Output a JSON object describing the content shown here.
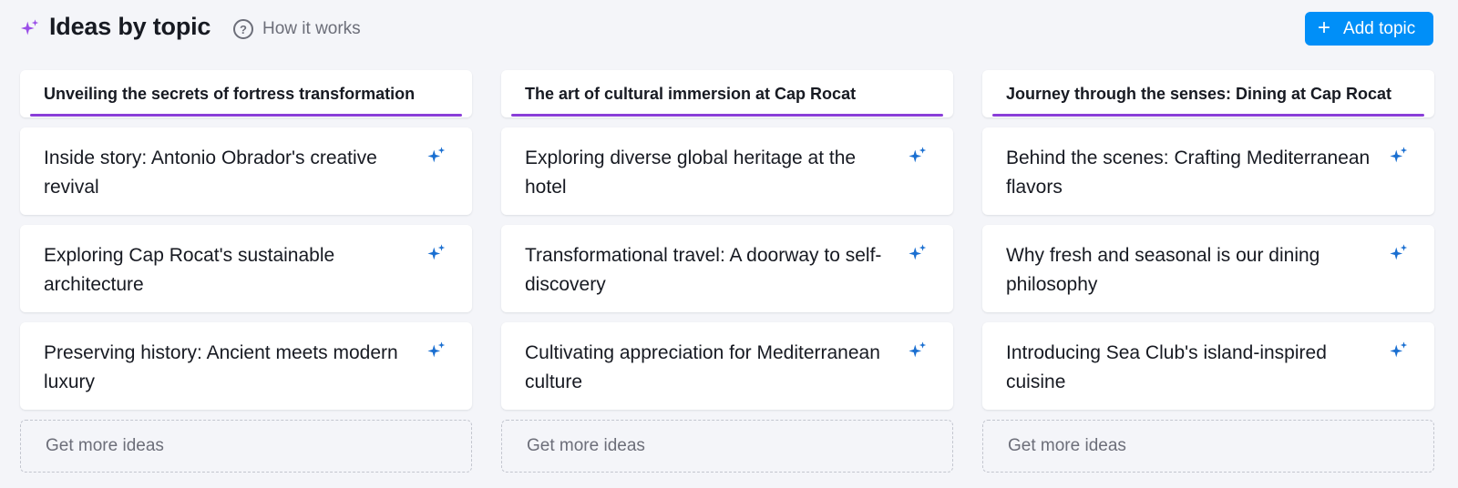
{
  "header": {
    "title": "Ideas by topic",
    "how_it_works": "How it works",
    "how_icon_glyph": "?",
    "add_topic_label": "Add topic",
    "add_topic_plus": "+"
  },
  "icons": {
    "title_icon": "sparkle-icon",
    "help_icon": "question-circle-icon",
    "idea_icon": "sparkle-icon"
  },
  "colors": {
    "accent_purple": "#8a3ed8",
    "button_blue": "#008ff8",
    "sparkle_blue": "#1a6fd1",
    "title_sparkle_purple": "#9a4ee8"
  },
  "columns": [
    {
      "topic": "Unveiling the secrets of fortress transformation",
      "ideas": [
        "Inside story: Antonio Obrador's creative revival",
        "Exploring Cap Rocat's sustainable architecture",
        "Preserving history: Ancient meets modern luxury"
      ],
      "more_label": "Get more ideas"
    },
    {
      "topic": "The art of cultural immersion at Cap Rocat",
      "ideas": [
        "Exploring diverse global heritage at the hotel",
        "Transformational travel: A doorway to self-discovery",
        "Cultivating appreciation for Mediterranean culture"
      ],
      "more_label": "Get more ideas"
    },
    {
      "topic": "Journey through the senses: Dining at Cap Rocat",
      "ideas": [
        "Behind the scenes: Crafting Mediterranean flavors",
        "Why fresh and seasonal is our dining philosophy",
        "Introducing Sea Club's island-inspired cuisine"
      ],
      "more_label": "Get more ideas"
    }
  ]
}
